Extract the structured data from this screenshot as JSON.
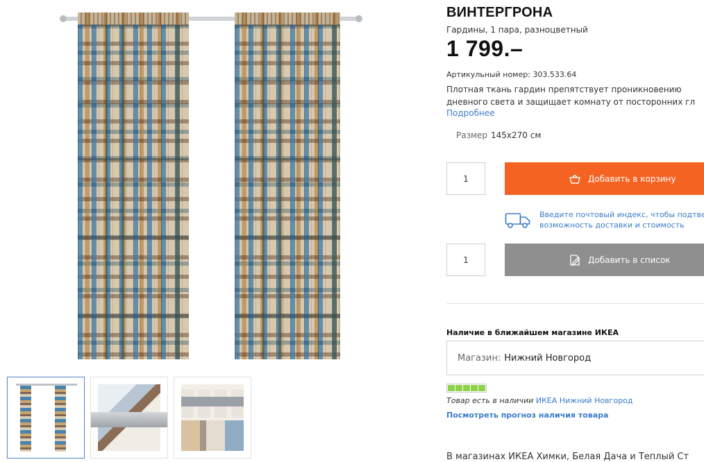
{
  "product": {
    "name": "ВИНТЕРГРОНА",
    "subtitle": "Гардины, 1 пара, разноцветный",
    "price": "1 799.–",
    "article_label": "Артикульный номер:",
    "article_number": "303.533.64",
    "description_line1": "Плотная ткань гардин препятствует проникновению",
    "description_line2": "дневного света и защищает комнату от посторонних гл",
    "more_link": "Подробнее",
    "size_label": "Размер",
    "size_value": "145х270 см"
  },
  "cart": {
    "quantity": "1",
    "button_label": "Добавить в корзину",
    "icon": "shopping-basket-icon"
  },
  "delivery": {
    "line1": "Введите почтовый индекс, чтобы подтвер",
    "line2": "возможность доставки и стоимость",
    "icon": "delivery-truck-icon"
  },
  "wishlist": {
    "quantity": "1",
    "button_label": "Добавить в список",
    "icon": "edit-list-icon"
  },
  "availability": {
    "title": "Наличие в ближайшем магазине ИКЕА",
    "store_label": "Магазин:",
    "store_value": "Нижний Новгород",
    "stock_level_bars": 5,
    "stock_text": "Товар есть в наличии",
    "stock_store": "ИКЕА Нижний Новгород",
    "forecast_link": "Посмотреть прогноз наличия товара"
  },
  "bottom_note": "В магазинах ИКЕА Химки, Белая Дача и Теплый Ст",
  "colors": {
    "accent_orange": "#f46322",
    "grey_button": "#8f8f8f",
    "link_blue": "#3b7bc8",
    "stock_green": "#8cd24a"
  }
}
